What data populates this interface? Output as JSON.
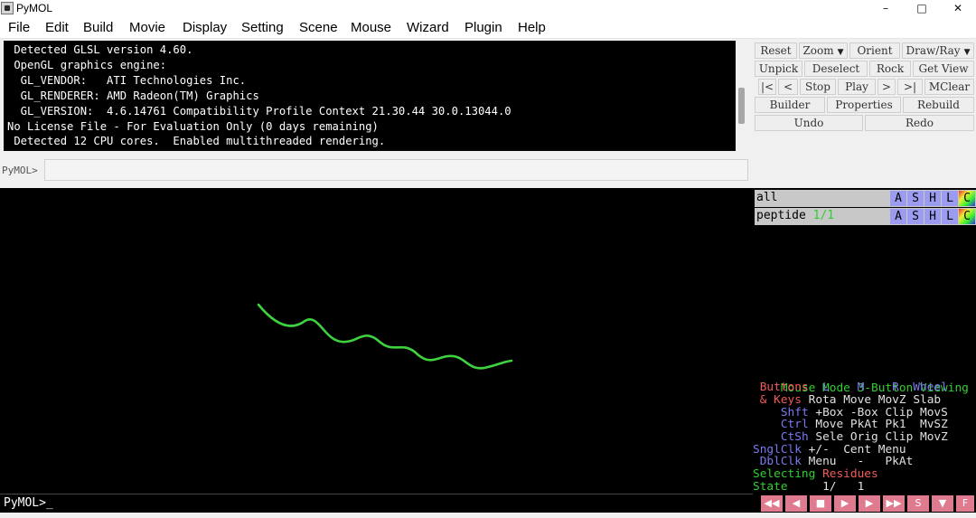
{
  "window": {
    "title": "PyMOL",
    "minimize": "–",
    "maximize": "□",
    "close": "✕"
  },
  "menu": [
    "File",
    "Edit",
    "Build",
    "Movie",
    "Display",
    "Setting",
    "Scene",
    "Mouse",
    "Wizard",
    "Plugin",
    "Help"
  ],
  "log_lines": [
    " Detected GLSL version 4.60.",
    " OpenGL graphics engine:",
    "  GL_VENDOR:   ATI Technologies Inc.",
    "  GL_RENDERER: AMD Radeon(TM) Graphics",
    "  GL_VERSION:  4.6.14761 Compatibility Profile Context 21.30.44 30.0.13044.0",
    "No License File - For Evaluation Only (0 days remaining)",
    " Detected 12 CPU cores.  Enabled multithreaded rendering."
  ],
  "command": {
    "prompt": "PyMOL>",
    "value": ""
  },
  "controls": {
    "row1": [
      "Reset",
      "Zoom",
      "Orient",
      "Draw/Ray"
    ],
    "row2": [
      "Unpick",
      "Deselect",
      "Rock",
      "Get View"
    ],
    "row3": [
      "|<",
      "<",
      "Stop",
      "Play",
      ">",
      ">|",
      "MClear"
    ],
    "row4": [
      "Builder",
      "Properties",
      "Rebuild"
    ],
    "row5": [
      "Undo",
      "Redo"
    ]
  },
  "objects": [
    {
      "name": "all",
      "state": ""
    },
    {
      "name": "peptide",
      "state": "1/1"
    }
  ],
  "ashlc": [
    "A",
    "S",
    "H",
    "L",
    "C"
  ],
  "ashlc_colors": [
    "#9b9bf0",
    "#9b9bf0",
    "#9b9bf0",
    "#9b9bf0",
    "#f0a030"
  ],
  "mouse": {
    "mode_label": "Mouse Mode",
    "mode_value": "3-Button Viewing",
    "buttons_label": " Buttons",
    "btn_l": "L",
    "btn_m": "M",
    "btn_r": "R",
    "btn_wheel": "Wheel",
    "keys_label": "& Keys",
    "rows": [
      {
        "key": "",
        "vals": [
          "Rota",
          "Move",
          "MovZ",
          "Slab"
        ]
      },
      {
        "key": "Shft",
        "vals": [
          "+Box",
          "-Box",
          "Clip",
          "MovS"
        ]
      },
      {
        "key": "Ctrl",
        "vals": [
          "Move",
          "PkAt",
          "Pk1",
          "MvSZ"
        ]
      },
      {
        "key": "CtSh",
        "vals": [
          "Sele",
          "Orig",
          "Clip",
          "MovZ"
        ]
      },
      {
        "key": "SnglClk",
        "vals": [
          "+/-",
          "Cent",
          "Menu",
          ""
        ]
      },
      {
        "key": "DblClk",
        "vals": [
          "Menu",
          "-",
          "PkAt",
          ""
        ]
      }
    ],
    "selecting_label": "Selecting",
    "selecting_value": "Residues",
    "state_label": "State",
    "state_value": "1/",
    "state_total": "1"
  },
  "bottom_prompt": "PyMOL>_",
  "playback": [
    "◀◀",
    "◀",
    "■",
    "▶",
    "▶",
    "▶▶",
    "S",
    "▼",
    "F"
  ],
  "colors": {
    "accent_green": "#2fcf2f",
    "mouse_label_red": "#f05a5a",
    "mouse_label_blue": "#7a7af0",
    "ribbon_green": "#3fd23f",
    "playback_pink": "#e07a8f"
  }
}
